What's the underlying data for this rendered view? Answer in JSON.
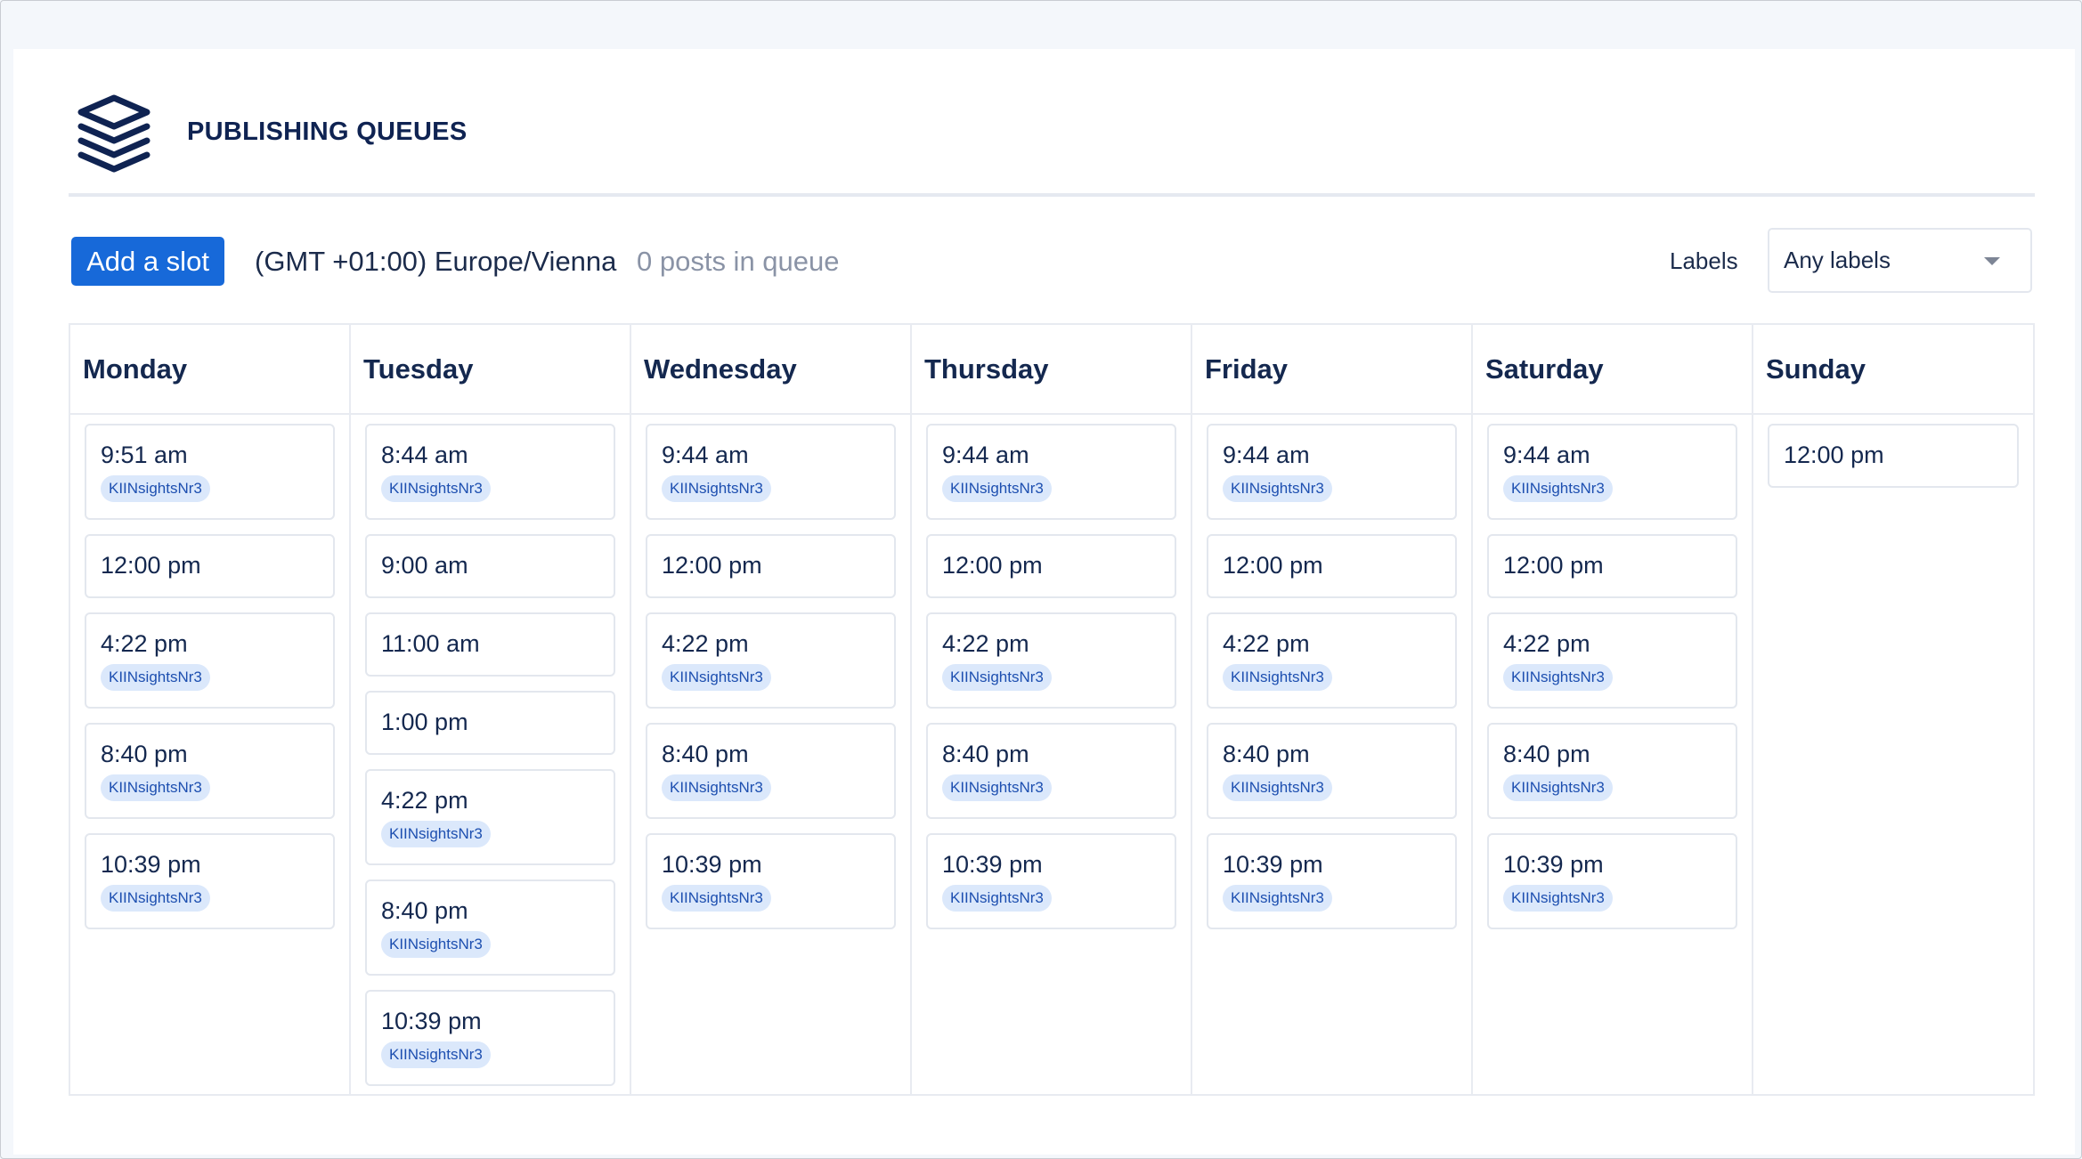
{
  "header": {
    "title": "PUBLISHING QUEUES",
    "logo_icon": "stacked-layers-icon"
  },
  "toolbar": {
    "add_slot_label": "Add a slot",
    "timezone": "(GMT +01:00) Europe/Vienna",
    "queue_count": "0 posts in queue",
    "labels_label": "Labels",
    "labels_select_value": "Any labels"
  },
  "colors": {
    "accent": "#1769d9",
    "tag_bg": "#dbe8fb",
    "tag_text": "#1d4fb0",
    "title": "#0f2352"
  },
  "days": [
    {
      "name": "Monday",
      "slots": [
        {
          "time": "9:51 am",
          "label": "KIINsightsNr3"
        },
        {
          "time": "12:00 pm",
          "label": ""
        },
        {
          "time": "4:22 pm",
          "label": "KIINsightsNr3"
        },
        {
          "time": "8:40 pm",
          "label": "KIINsightsNr3"
        },
        {
          "time": "10:39 pm",
          "label": "KIINsightsNr3"
        }
      ]
    },
    {
      "name": "Tuesday",
      "slots": [
        {
          "time": "8:44 am",
          "label": "KIINsightsNr3"
        },
        {
          "time": "9:00 am",
          "label": ""
        },
        {
          "time": "11:00 am",
          "label": ""
        },
        {
          "time": "1:00 pm",
          "label": ""
        },
        {
          "time": "4:22 pm",
          "label": "KIINsightsNr3"
        },
        {
          "time": "8:40 pm",
          "label": "KIINsightsNr3"
        },
        {
          "time": "10:39 pm",
          "label": "KIINsightsNr3"
        }
      ]
    },
    {
      "name": "Wednesday",
      "slots": [
        {
          "time": "9:44 am",
          "label": "KIINsightsNr3"
        },
        {
          "time": "12:00 pm",
          "label": ""
        },
        {
          "time": "4:22 pm",
          "label": "KIINsightsNr3"
        },
        {
          "time": "8:40 pm",
          "label": "KIINsightsNr3"
        },
        {
          "time": "10:39 pm",
          "label": "KIINsightsNr3"
        }
      ]
    },
    {
      "name": "Thursday",
      "slots": [
        {
          "time": "9:44 am",
          "label": "KIINsightsNr3"
        },
        {
          "time": "12:00 pm",
          "label": ""
        },
        {
          "time": "4:22 pm",
          "label": "KIINsightsNr3"
        },
        {
          "time": "8:40 pm",
          "label": "KIINsightsNr3"
        },
        {
          "time": "10:39 pm",
          "label": "KIINsightsNr3"
        }
      ]
    },
    {
      "name": "Friday",
      "slots": [
        {
          "time": "9:44 am",
          "label": "KIINsightsNr3"
        },
        {
          "time": "12:00 pm",
          "label": ""
        },
        {
          "time": "4:22 pm",
          "label": "KIINsightsNr3"
        },
        {
          "time": "8:40 pm",
          "label": "KIINsightsNr3"
        },
        {
          "time": "10:39 pm",
          "label": "KIINsightsNr3"
        }
      ]
    },
    {
      "name": "Saturday",
      "slots": [
        {
          "time": "9:44 am",
          "label": "KIINsightsNr3"
        },
        {
          "time": "12:00 pm",
          "label": ""
        },
        {
          "time": "4:22 pm",
          "label": "KIINsightsNr3"
        },
        {
          "time": "8:40 pm",
          "label": "KIINsightsNr3"
        },
        {
          "time": "10:39 pm",
          "label": "KIINsightsNr3"
        }
      ]
    },
    {
      "name": "Sunday",
      "slots": [
        {
          "time": "12:00 pm",
          "label": ""
        }
      ]
    }
  ]
}
